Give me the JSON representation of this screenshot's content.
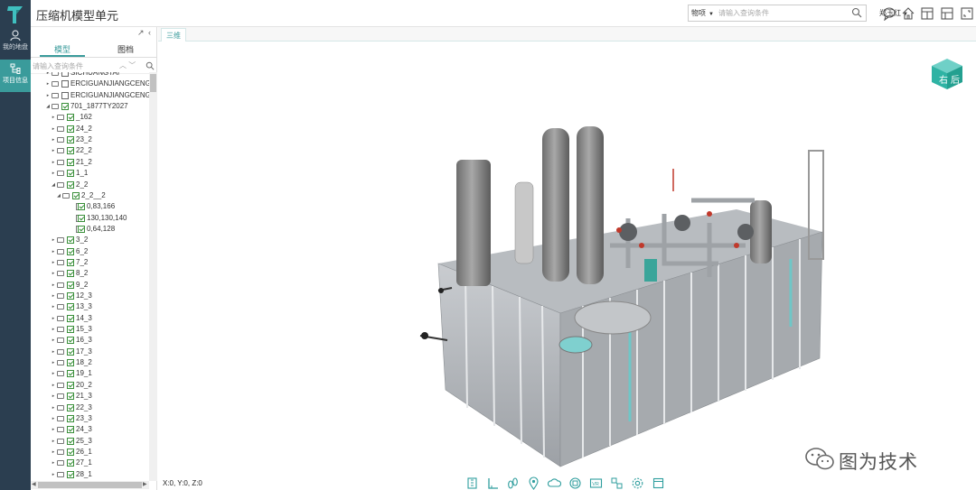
{
  "app": {
    "title": "压缩机模型单元",
    "colors": {
      "rail": "#2b3e50",
      "accent": "#3a9b9b",
      "check": "#2f8a2f"
    }
  },
  "rail": {
    "logo_icon": "brand-logo-icon",
    "items": [
      {
        "label": "我的地盘",
        "icon": "user-icon"
      },
      {
        "label": "项目信息",
        "icon": "project-tree-icon",
        "active": true
      }
    ]
  },
  "header": {
    "search": {
      "category": "物项",
      "placeholder": "请输入查询条件"
    },
    "user": "郑玉红",
    "icons": [
      "chat-bubble-icon",
      "home-icon",
      "layout-icon",
      "layout-split-icon",
      "fullscreen-icon"
    ]
  },
  "panel": {
    "tabs": [
      {
        "label": "模型",
        "active": true
      },
      {
        "label": "图档"
      }
    ],
    "search_placeholder": "请输入查询条件",
    "tree": [
      {
        "label": "SICHUANGTAI",
        "indent": 1,
        "exp": "▸",
        "check": "off",
        "partial": true
      },
      {
        "label": "ERCIGUANJIANGCENG",
        "indent": 1,
        "exp": "▸",
        "check": "off"
      },
      {
        "label": "ERCIGUANJIANGCENG-",
        "indent": 1,
        "exp": "▸",
        "check": "off"
      },
      {
        "label": "701_1877TY2027",
        "indent": 1,
        "exp": "◢",
        "check": "on"
      },
      {
        "label": "_162",
        "indent": 2,
        "exp": "▸",
        "check": "on"
      },
      {
        "label": "24_2",
        "indent": 2,
        "exp": "▸",
        "check": "on"
      },
      {
        "label": "23_2",
        "indent": 2,
        "exp": "▸",
        "check": "on"
      },
      {
        "label": "22_2",
        "indent": 2,
        "exp": "▸",
        "check": "on"
      },
      {
        "label": "21_2",
        "indent": 2,
        "exp": "▸",
        "check": "on"
      },
      {
        "label": "1_1",
        "indent": 2,
        "exp": "▸",
        "check": "on"
      },
      {
        "label": "2_2",
        "indent": 2,
        "exp": "◢",
        "check": "on"
      },
      {
        "label": "2_2__2",
        "indent": 3,
        "exp": "◢",
        "check": "on"
      },
      {
        "label": "0,83,166",
        "indent": 4,
        "file": true,
        "check": "on"
      },
      {
        "label": "130,130,140",
        "indent": 4,
        "file": true,
        "check": "on"
      },
      {
        "label": "0,64,128",
        "indent": 4,
        "file": true,
        "check": "on"
      },
      {
        "label": "3_2",
        "indent": 2,
        "exp": "▸",
        "check": "on"
      },
      {
        "label": "6_2",
        "indent": 2,
        "exp": "▸",
        "check": "on"
      },
      {
        "label": "7_2",
        "indent": 2,
        "exp": "▸",
        "check": "on"
      },
      {
        "label": "8_2",
        "indent": 2,
        "exp": "▸",
        "check": "on"
      },
      {
        "label": "9_2",
        "indent": 2,
        "exp": "▸",
        "check": "on"
      },
      {
        "label": "12_3",
        "indent": 2,
        "exp": "▸",
        "check": "on"
      },
      {
        "label": "13_3",
        "indent": 2,
        "exp": "▸",
        "check": "on"
      },
      {
        "label": "14_3",
        "indent": 2,
        "exp": "▸",
        "check": "on"
      },
      {
        "label": "15_3",
        "indent": 2,
        "exp": "▸",
        "check": "on"
      },
      {
        "label": "16_3",
        "indent": 2,
        "exp": "▸",
        "check": "on"
      },
      {
        "label": "17_3",
        "indent": 2,
        "exp": "▸",
        "check": "on"
      },
      {
        "label": "18_2",
        "indent": 2,
        "exp": "▸",
        "check": "on"
      },
      {
        "label": "19_1",
        "indent": 2,
        "exp": "▸",
        "check": "on"
      },
      {
        "label": "20_2",
        "indent": 2,
        "exp": "▸",
        "check": "on"
      },
      {
        "label": "21_3",
        "indent": 2,
        "exp": "▸",
        "check": "on"
      },
      {
        "label": "22_3",
        "indent": 2,
        "exp": "▸",
        "check": "on"
      },
      {
        "label": "23_3",
        "indent": 2,
        "exp": "▸",
        "check": "on"
      },
      {
        "label": "24_3",
        "indent": 2,
        "exp": "▸",
        "check": "on"
      },
      {
        "label": "25_3",
        "indent": 2,
        "exp": "▸",
        "check": "on"
      },
      {
        "label": "26_1",
        "indent": 2,
        "exp": "▸",
        "check": "on"
      },
      {
        "label": "27_1",
        "indent": 2,
        "exp": "▸",
        "check": "on"
      },
      {
        "label": "28_1",
        "indent": 2,
        "exp": "▸",
        "check": "on"
      }
    ]
  },
  "main": {
    "tab": "三维",
    "view_cube": {
      "left": "右",
      "right": "后"
    },
    "coords": "X:0, Y:0, Z:0",
    "toolbar_icons": [
      "measure-icon",
      "angle-icon",
      "walk-icon",
      "location-pin-icon",
      "cloud-icon",
      "section-icon",
      "vr-icon",
      "explode-icon",
      "settings-icon",
      "box-icon"
    ]
  },
  "watermark": {
    "text": "图为技术",
    "icon": "wechat-icon"
  }
}
